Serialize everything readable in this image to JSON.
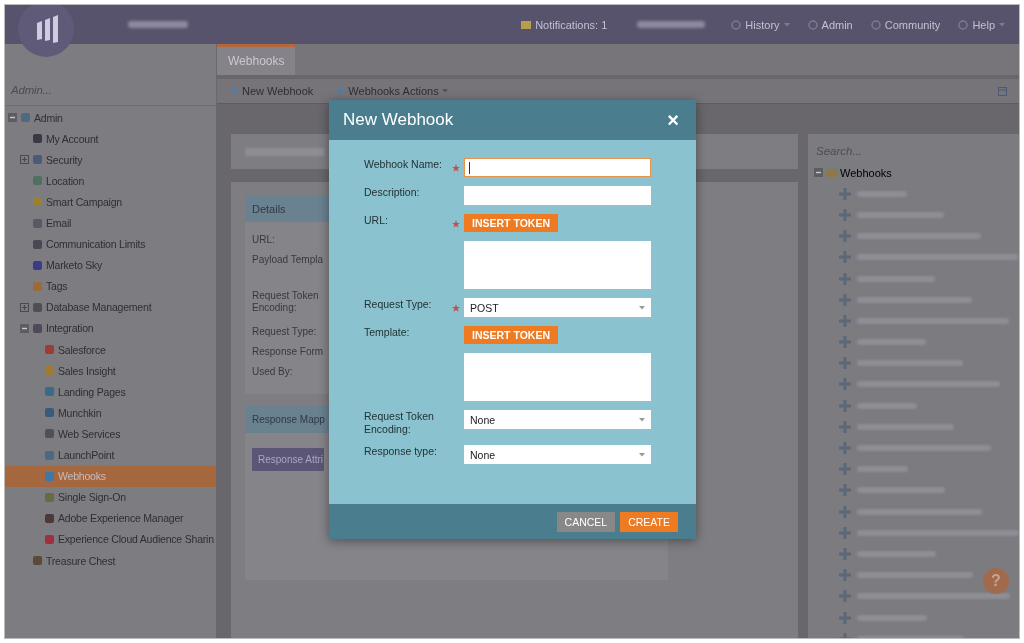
{
  "topbar": {
    "notifications": "Notifications: 1",
    "links": [
      {
        "label": "History",
        "dropdown": true
      },
      {
        "label": "Admin",
        "dropdown": false
      },
      {
        "label": "Community",
        "dropdown": false
      },
      {
        "label": "Help",
        "dropdown": true
      }
    ]
  },
  "sidebar": {
    "search_placeholder": "Admin...",
    "tree": [
      {
        "label": "Admin",
        "expanded": true,
        "selected": false,
        "children": [
          {
            "label": "My Account",
            "selected": false
          },
          {
            "label": "Security",
            "expanded": false,
            "selected": false
          },
          {
            "label": "Location",
            "selected": false
          },
          {
            "label": "Smart Campaign",
            "selected": false
          },
          {
            "label": "Email",
            "selected": false
          },
          {
            "label": "Communication Limits",
            "selected": false
          },
          {
            "label": "Marketo Sky",
            "selected": false
          },
          {
            "label": "Tags",
            "selected": false
          },
          {
            "label": "Database Management",
            "expanded": false,
            "selected": false
          },
          {
            "label": "Integration",
            "expanded": true,
            "selected": false,
            "children": [
              {
                "label": "Salesforce",
                "selected": false
              },
              {
                "label": "Sales Insight",
                "selected": false
              },
              {
                "label": "Landing Pages",
                "selected": false
              },
              {
                "label": "Munchkin",
                "selected": false
              },
              {
                "label": "Web Services",
                "selected": false
              },
              {
                "label": "LaunchPoint",
                "selected": false
              },
              {
                "label": "Webhooks",
                "selected": true
              },
              {
                "label": "Single Sign-On",
                "selected": false
              },
              {
                "label": "Adobe Experience Manager",
                "selected": false
              },
              {
                "label": "Experience Cloud Audience Sharin",
                "selected": false
              }
            ]
          },
          {
            "label": "Treasure Chest",
            "selected": false
          }
        ]
      }
    ]
  },
  "tabs": [
    {
      "label": "Webhooks",
      "selected": true
    }
  ],
  "toolbar": [
    {
      "label": "New Webhook",
      "dropdown": false
    },
    {
      "label": "Webhooks Actions",
      "dropdown": true
    }
  ],
  "details": {
    "header": "Details",
    "labels": [
      "URL:",
      "Payload Templa",
      "Request Token Encoding:",
      "Request Type:",
      "Response Form",
      "Used By:"
    ],
    "mapping_header": "Response Mapp",
    "mapping_button": "Response Attri"
  },
  "webhook_list": {
    "search_placeholder": "Search...",
    "root": "Webhooks",
    "expanded": true,
    "items": [
      {
        "kind": "redacted"
      },
      {
        "kind": "redacted"
      },
      {
        "kind": "redacted"
      },
      {
        "kind": "redacted"
      },
      {
        "kind": "redacted"
      },
      {
        "kind": "redacted"
      },
      {
        "kind": "redacted"
      },
      {
        "kind": "redacted"
      },
      {
        "kind": "redacted"
      },
      {
        "kind": "redacted"
      },
      {
        "kind": "redacted"
      },
      {
        "kind": "redacted"
      },
      {
        "kind": "redacted"
      },
      {
        "kind": "redacted"
      },
      {
        "kind": "redacted"
      },
      {
        "kind": "redacted"
      },
      {
        "kind": "redacted"
      },
      {
        "kind": "redacted"
      },
      {
        "kind": "redacted"
      },
      {
        "kind": "redacted"
      },
      {
        "kind": "redacted"
      },
      {
        "kind": "redacted"
      }
    ]
  },
  "help": "?",
  "dialog": {
    "title": "New Webhook",
    "close": "×",
    "fields": [
      {
        "kind": "text",
        "label": "Webhook Name:",
        "required": true,
        "focused": true
      },
      {
        "kind": "text",
        "label": "Description:",
        "required": false,
        "focused": false
      },
      {
        "kind": "token",
        "label": "URL:",
        "required": true,
        "button": "INSERT TOKEN"
      },
      {
        "kind": "select",
        "label": "Request Type:",
        "required": true,
        "value": "POST"
      },
      {
        "kind": "token",
        "label": "Template:",
        "required": false,
        "button": "INSERT TOKEN"
      },
      {
        "kind": "select",
        "label": "Request Token Encoding:",
        "required": false,
        "value": "None"
      },
      {
        "kind": "select",
        "label": "Response type:",
        "required": false,
        "value": "None"
      }
    ],
    "buttons": [
      {
        "label": "CANCEL",
        "primary": false
      },
      {
        "label": "CREATE",
        "primary": true
      }
    ]
  }
}
